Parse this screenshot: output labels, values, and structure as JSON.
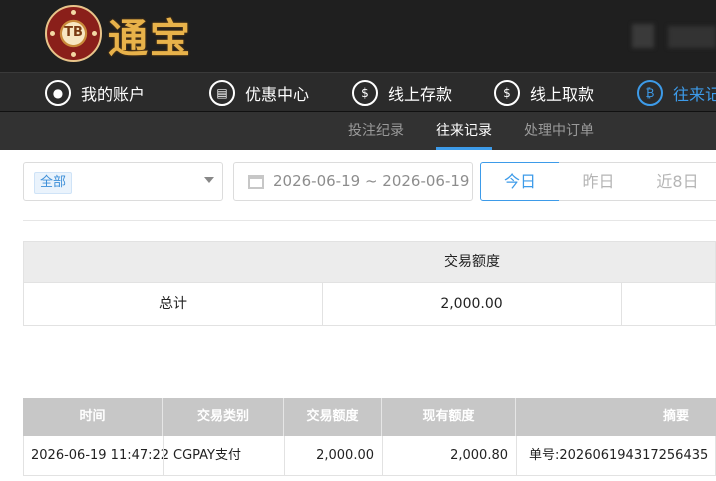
{
  "header": {
    "logo_badge_text": "TB",
    "logo_text": "通宝"
  },
  "nav": {
    "items": [
      {
        "label": "我的账户",
        "icon": "user-icon"
      },
      {
        "label": "优惠中心",
        "icon": "gift-icon"
      },
      {
        "label": "线上存款",
        "icon": "deposit-icon"
      },
      {
        "label": "线上取款",
        "icon": "withdraw-icon"
      },
      {
        "label": "往来记",
        "icon": "records-icon",
        "active": true
      }
    ]
  },
  "subnav": {
    "items": [
      {
        "label": "投注纪录"
      },
      {
        "label": "往来记录",
        "active": true
      },
      {
        "label": "处理中订单"
      }
    ]
  },
  "filters": {
    "type_selected": "全部",
    "date_range": "2026-06-19 ~ 2026-06-19",
    "quick": [
      "今日",
      "昨日",
      "近8日"
    ]
  },
  "summary": {
    "header": "交易额度",
    "row_label": "总计",
    "row_value": "2,000.00"
  },
  "records": {
    "columns": [
      "时间",
      "交易类别",
      "交易额度",
      "现有额度",
      "摘要"
    ],
    "rows": [
      {
        "time": "2026-06-19 11:47:22",
        "type": "CGPAY支付",
        "amount": "2,000.00",
        "balance": "2,000.80",
        "summary": "单号:202606194317256435"
      }
    ]
  },
  "colors": {
    "accent": "#3d9be9",
    "header_bg": "#1f1f1f",
    "nav_bg": "#2b2b2b",
    "logo_gold": "#e8b24a"
  }
}
